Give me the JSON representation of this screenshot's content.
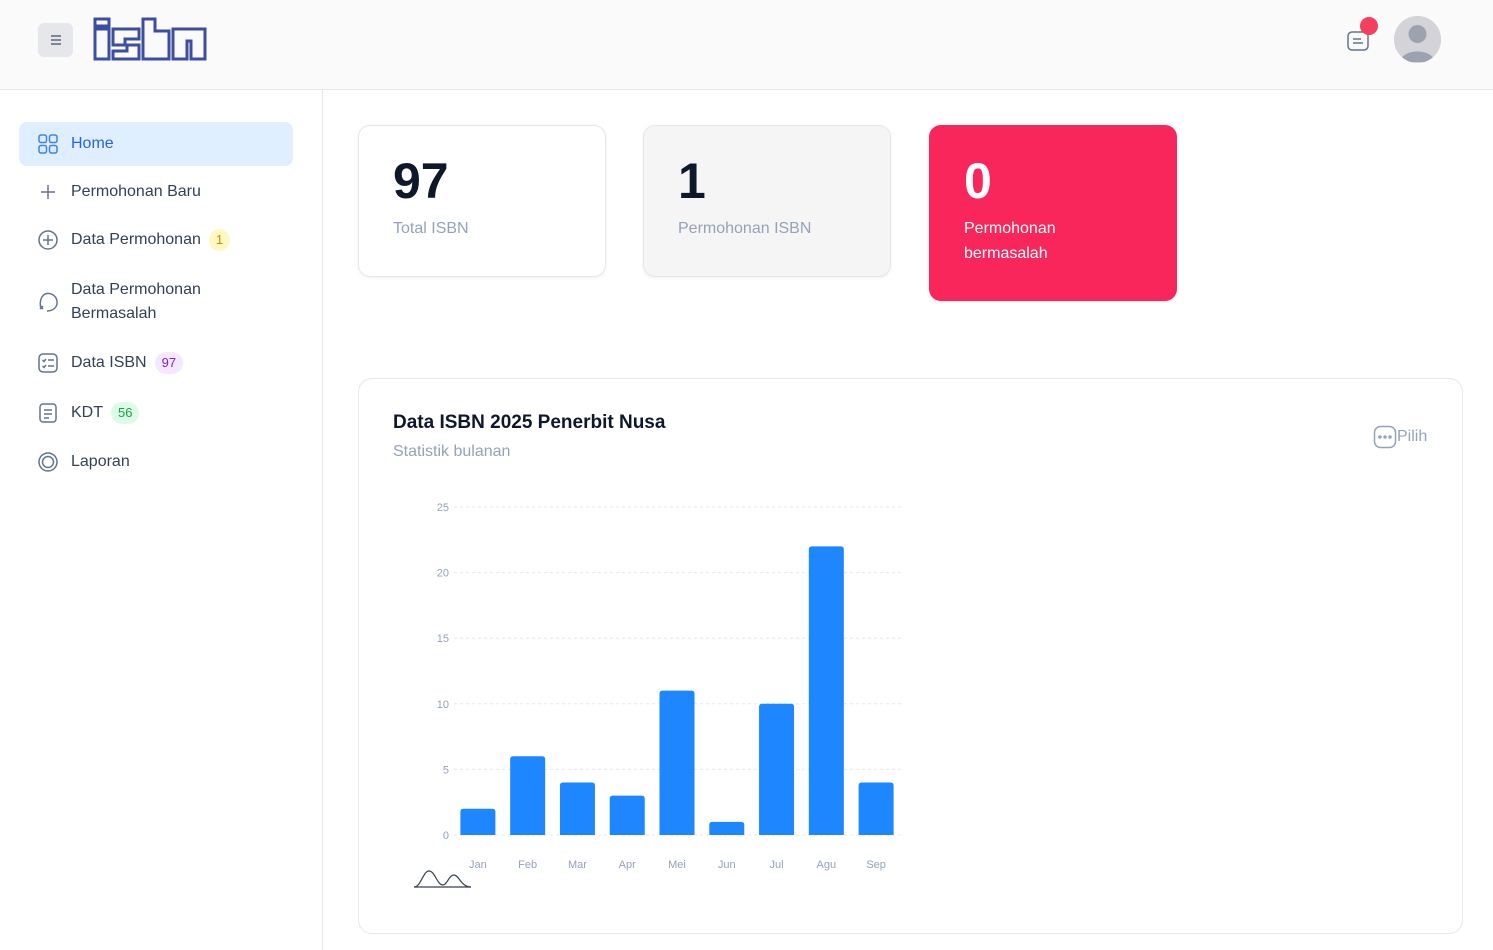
{
  "header": {
    "logo_text": "isbn",
    "menu_icon": "menu-icon",
    "notification_icon": "chat-icon",
    "avatar_icon": "user-icon"
  },
  "sidebar": {
    "items": [
      {
        "label": "Home",
        "icon": "grid-icon",
        "active": true
      },
      {
        "label": "Permohonan Baru",
        "icon": "plus-icon"
      },
      {
        "label": "Data Permohonan",
        "icon": "plus-circle-icon",
        "badge": "1"
      },
      {
        "label": "Data Permohonan Bermasalah",
        "icon": "error-file-icon"
      },
      {
        "label": "Data ISBN",
        "icon": "list-icon",
        "badge": "97"
      },
      {
        "label": "KDT",
        "icon": "document-icon",
        "badge": "56"
      },
      {
        "label": "Laporan",
        "icon": "report-icon"
      }
    ]
  },
  "stats": [
    {
      "value": "97",
      "label": "Total ISBN"
    },
    {
      "value": "1",
      "label": "Permohonan ISBN"
    },
    {
      "value": "0",
      "label": "Permohonan bermasalah"
    }
  ],
  "chart_panel": {
    "title": "Data ISBN 2025 Penerbit Nusa",
    "subtitle": "Statistik bulanan",
    "pick_label": "Pilih"
  },
  "chart_data": {
    "type": "bar",
    "categories": [
      "Jan",
      "Feb",
      "Mar",
      "Apr",
      "Mei",
      "Jun",
      "Jul",
      "Agu",
      "Sep"
    ],
    "values": [
      2,
      6,
      4,
      3,
      11,
      1,
      10,
      22,
      4
    ],
    "yticks": [
      0,
      5,
      10,
      15,
      20,
      25
    ],
    "ylim": [
      0,
      25
    ],
    "grid": true,
    "bar_color": "#1e86ff"
  },
  "colors": {
    "accent": "#2563eb",
    "danger": "#f9265b"
  }
}
